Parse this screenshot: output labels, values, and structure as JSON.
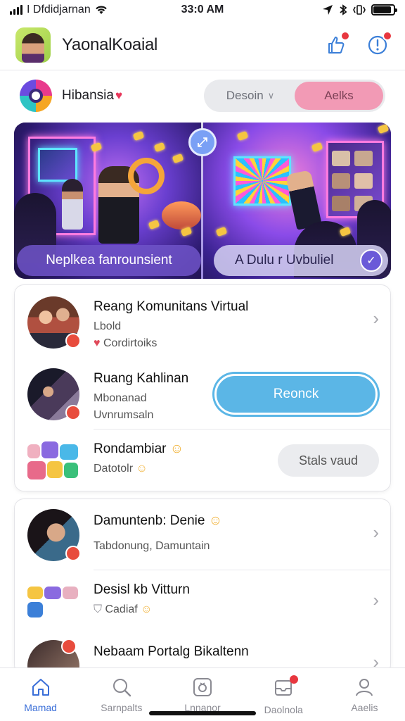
{
  "status_bar": {
    "carrier": "I Dfdidjarnan",
    "time": "33:0 AM",
    "battery_level": 0.9
  },
  "header": {
    "title": "YaonalKoaial",
    "icons": [
      "avatar",
      "thumb-up-icon",
      "notification-icon"
    ]
  },
  "filter": {
    "space_name": "Hibansia",
    "segments": [
      {
        "label": "Desoin",
        "active": false
      },
      {
        "label": "Aelks",
        "active": true
      }
    ]
  },
  "hero": {
    "left_label": "Neplkea fanrounsient",
    "right_label": "A Dulu r Uvbuliel"
  },
  "list1": [
    {
      "title": "Reang Komunitans Virtual",
      "line1": "Lbold",
      "line2": "Cordirtoiks"
    },
    {
      "title": "Ruang Kahlinan",
      "line1": "Mbonanad",
      "line2": "Uvnrumsaln",
      "action": "Reonck"
    },
    {
      "title": "Rondambiar",
      "line1": "Datotolr",
      "action": "Stals vaud"
    }
  ],
  "list2": [
    {
      "title": "Damuntenb: Denie",
      "line1": "Tabdonung, Damuntain"
    },
    {
      "title": "Desisl kb Vitturn",
      "line1": "Cadiaf"
    },
    {
      "title": "Nebaam Portalg Bikaltenn"
    }
  ],
  "tabs": [
    {
      "label": "Mamad",
      "icon": "home-icon",
      "active": true
    },
    {
      "label": "Sarnpalts",
      "icon": "search-icon",
      "active": false
    },
    {
      "label": "Lnnanor",
      "icon": "ring-icon",
      "active": false
    },
    {
      "label": "Daolnola",
      "icon": "inbox-icon",
      "active": false
    },
    {
      "label": "Aaelis",
      "icon": "profile-icon",
      "active": false
    }
  ],
  "colors": {
    "accent_blue": "#5bb6e6",
    "active_tab": "#3b6fd8",
    "segment_active": "#f29ab5",
    "badge_red": "#e8373f"
  }
}
